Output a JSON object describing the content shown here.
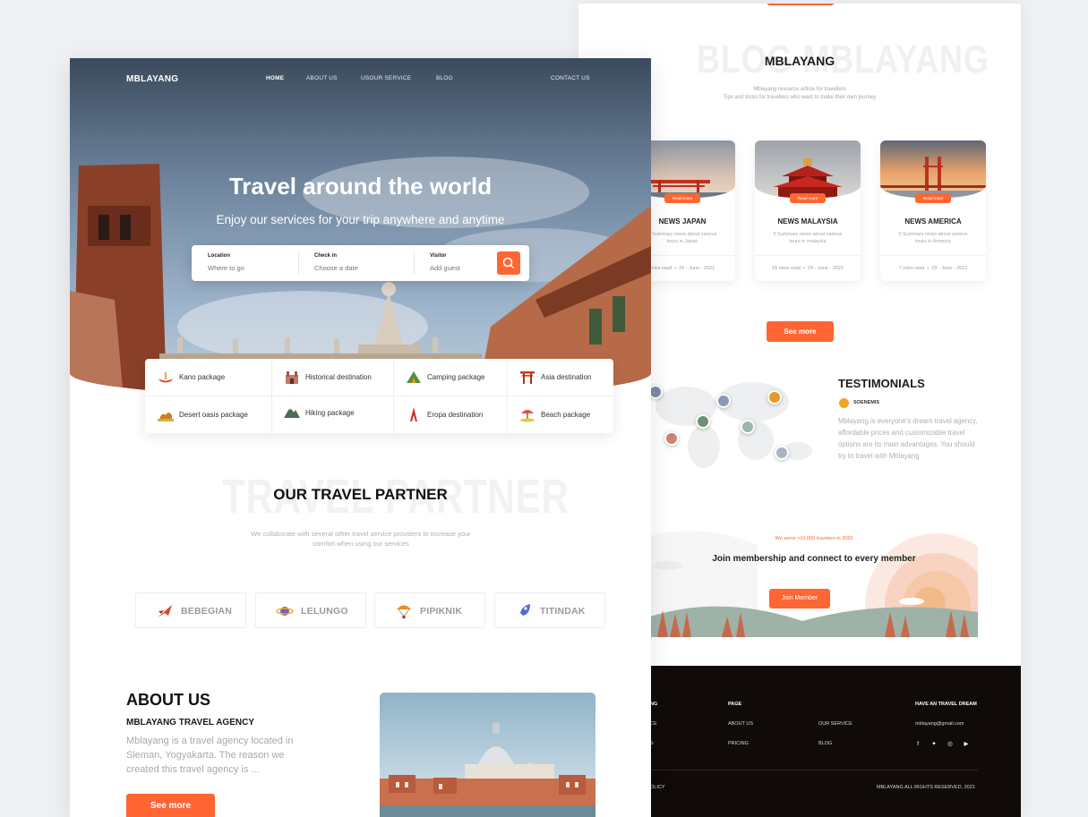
{
  "colors": {
    "accent": "#ff6633",
    "footer": "#100b09",
    "text_dark": "#1c1c1c",
    "text_muted": "#a9a9a9"
  },
  "front_page": {
    "logo": "MBLAYANG",
    "nav": {
      "home": "HOME",
      "about": "ABOUT US",
      "service": "USOUR SERVICE",
      "blog": "BLOG",
      "contact": "CONTACT US"
    },
    "hero": {
      "title": "Travel around the world",
      "subtitle": "Enjoy our services for your trip anywhere and anytime"
    },
    "search": {
      "location_label": "Location",
      "location_placeholder": "Where to go",
      "checkin_label": "Check in",
      "checkin_placeholder": "Choose a date",
      "visitor_label": "Visitor",
      "visitor_placeholder": "Add guest",
      "button_icon": "search-icon"
    },
    "packages": [
      {
        "label": "Kano package",
        "icon": "canoe-icon"
      },
      {
        "label": "Historical destination",
        "icon": "castle-icon"
      },
      {
        "label": "Camping package",
        "icon": "tent-icon"
      },
      {
        "label": "Asia destination",
        "icon": "torii-gate-icon"
      },
      {
        "label": "Desert oasis package",
        "icon": "camel-icon"
      },
      {
        "label": "Hiking package",
        "icon": "mountain-icon"
      },
      {
        "label": "Eropa destination",
        "icon": "rocket-tower-icon"
      },
      {
        "label": "Beach package",
        "icon": "beach-umbrella-icon"
      }
    ],
    "travel_partner": {
      "background_word": "TRAVEL PARTNER",
      "title": "OUR TRAVEL PARTNER",
      "subtitle": "We collaborate with several other travel service providers to increase your comfort when using our services"
    },
    "partners": [
      {
        "name": "BEBEGIAN",
        "icon": "airplane-icon"
      },
      {
        "name": "LELUNGO",
        "icon": "planet-icon"
      },
      {
        "name": "PIPIKNIK",
        "icon": "paraglider-icon"
      },
      {
        "name": "TITINDAK",
        "icon": "rocket-icon"
      }
    ],
    "about": {
      "title": "ABOUT US",
      "subtitle": "MBLAYANG TRAVEL AGENCY",
      "text": "Mblayang is a travel agency located in Sleman, Yogyakarta. The reason we created this travel agency is ...",
      "button": "See more"
    }
  },
  "back_page": {
    "blog": {
      "background_word": "BLOG MBLAYANG",
      "title": "MBLAYANG",
      "subtitle_1": "Mblayang resource article for travellers",
      "subtitle_2": "Tips and tricks for travellers who want to make their own journey"
    },
    "cards": [
      {
        "badge": "Read more",
        "title": "NEWS JAPAN",
        "desc": "5 Summary news about various tours in Japan",
        "read": "mins read",
        "date": "29 - June - 2021"
      },
      {
        "badge": "Read more",
        "title": "NEWS MALAYSIA",
        "desc": "5 Summary news about various tours in malaysia",
        "read": "15 mins read",
        "date": "29 - June - 2021"
      },
      {
        "badge": "Read more",
        "title": "NEWS AMERICA",
        "desc": "5 Summary news about various tours in America",
        "read": "7 mins read",
        "date": "29 - June - 2021"
      }
    ],
    "see_more": "See more",
    "testimonials": {
      "title": "TESTIMONIALS",
      "name": "SOENEMIS",
      "text": "Mblayang is everyone's dream travel agency, affordable prices and customizable travel options are its main advantages. You should try to travel with Mblayang"
    },
    "membership": {
      "small": "We serve +10,000 travelers in 2020",
      "title": "Join membership and connect to every member",
      "button": "Join Member"
    },
    "footer": {
      "brand_fragment": "NG",
      "page_head": "PAGE",
      "col1": [
        "CE",
        "S"
      ],
      "col2": [
        "ABOUT US",
        "PRICING"
      ],
      "col3": [
        "OUR SERVICE",
        "BLOG"
      ],
      "contact_head": "HAVE AN TRAVEL DREAM",
      "email": "mblayang@gmail.com",
      "social": [
        "f",
        "t",
        "ig",
        "yt"
      ],
      "policy": "OLICY",
      "copyright": "MBLAYANG ALL RIGHTS RESERVED, 2021"
    }
  }
}
